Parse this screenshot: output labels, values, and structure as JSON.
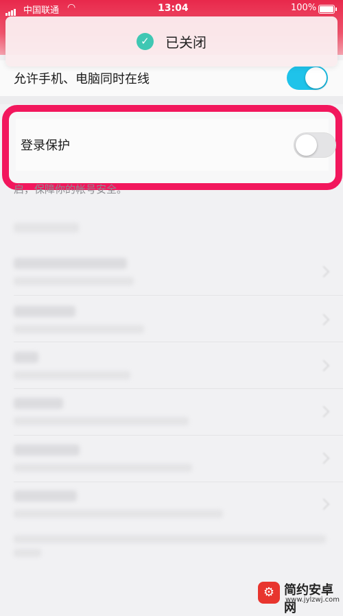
{
  "status_bar": {
    "carrier": "中国联通",
    "wifi_icon": "wifi-icon",
    "time": "13:04",
    "battery_text": "100%"
  },
  "toast": {
    "icon": "check-circle-icon",
    "text": "已关闭",
    "accent": "#3fc7b3"
  },
  "settings": {
    "online_label": "允许手机、电脑同时在线",
    "online_state": "on",
    "protect_label": "登录保护",
    "protect_state": "off",
    "protect_desc": "启，保障你的帐号安全。"
  },
  "colors": {
    "header": "#e8284b",
    "toggle_on": "#1fc3ea",
    "highlight": "#f2175d"
  },
  "watermark": {
    "logo_icon": "android-icon",
    "text": "简约安卓网",
    "url": "www.jylzwj.com"
  }
}
